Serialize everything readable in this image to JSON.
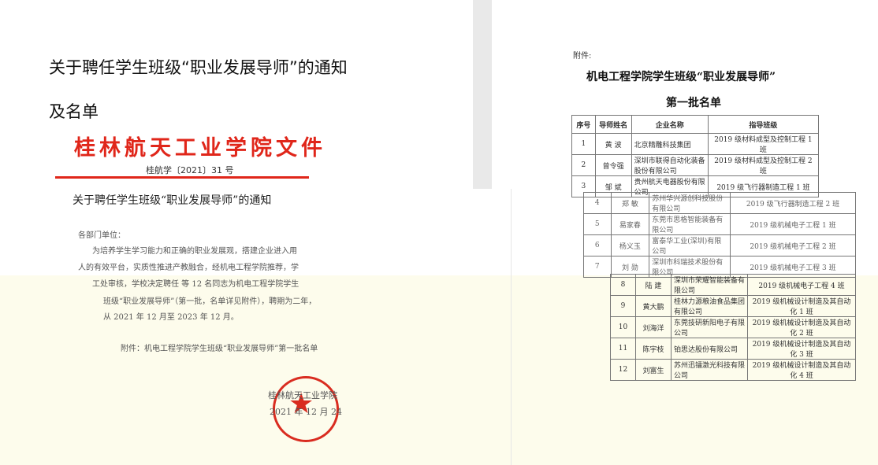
{
  "headline": {
    "line1": "关于聘任学生班级“职业发展导师”的通知",
    "line2": "及名单"
  },
  "doc": {
    "red_title": "桂林航天工业学院文件",
    "doc_number": "桂航学〔2021〕31 号",
    "notice_title": "关于聘任学生班级“职业发展导师”的通知",
    "salutation": "各部门单位：",
    "body": [
      "为培养学生学习能力和正确的职业发展观，搭建企业进入用",
      "人的有效平台，实质性推进产教融合，经机电工程学院推荐，学",
      "工处审核，学校决定聘任     等 12 名同志为机电工程学院学生",
      "班级“职业发展导师”（第一批，名单详见附件），聘期为二年，",
      "从 2021 年 12 月至 2023 年 12 月。"
    ],
    "attachment_note": "附件：机电工程学院学生班级“职业发展导师”第一批名单",
    "stamp_text": "桂林航天工业学院",
    "stamp_date": "2021 年 12 月 24",
    "stamp_color": "#d92c20",
    "header_color": "#e0261a"
  },
  "list": {
    "attach_label": "附件:",
    "title1": "机电工程学院学生班级“职业发展导师”",
    "title2": "第一批名单",
    "headers": [
      "序号",
      "导师姓名",
      "企业名称",
      "指导班级"
    ],
    "rows_top": [
      [
        "1",
        "黄 波",
        "北京精雕科技集团",
        "2019 级材料成型及控制工程 1 班"
      ],
      [
        "2",
        "曾令强",
        "深圳市联得自动化装备股份有限公司",
        "2019 级材料成型及控制工程 2 班"
      ],
      [
        "3",
        "邹 斌",
        "贵州航天电器股份有限公司",
        "2019 级飞行器制造工程 1 班"
      ]
    ],
    "rows_mid": [
      [
        "4",
        "郑 敏",
        "苏州华兴源创科技股份有限公司",
        "2019 级飞行器制造工程 2 班"
      ],
      [
        "5",
        "易家春",
        "东莞市思格智能装备有限公司",
        "2019 级机械电子工程 1 班"
      ],
      [
        "6",
        "杨义玉",
        "富泰华工业(深圳)有限公司",
        "2019 级机械电子工程 2 班"
      ],
      [
        "7",
        "刘 勋",
        "深圳市科瑞技术股份有限公司",
        "2019 级机械电子工程 3 班"
      ]
    ],
    "rows_bot": [
      [
        "8",
        "陆 建",
        "深圳市荣耀智能装备有限公司",
        "2019 级机械电子工程 4 班"
      ],
      [
        "9",
        "黄大鹏",
        "桂林力源粮油食品集团有限公司",
        "2019 级机械设计制造及其自动化 1 班"
      ],
      [
        "10",
        "刘海洋",
        "东莞技研新阳电子有限公司",
        "2019 级机械设计制造及其自动化 2 班"
      ],
      [
        "11",
        "陈宇枝",
        "铂思达股份有限公司",
        "2019 级机械设计制造及其自动化 3 班"
      ],
      [
        "12",
        "刘富生",
        "苏州迅镭激光科技有限公司",
        "2019 级机械设计制造及其自动化 4 班"
      ]
    ]
  }
}
